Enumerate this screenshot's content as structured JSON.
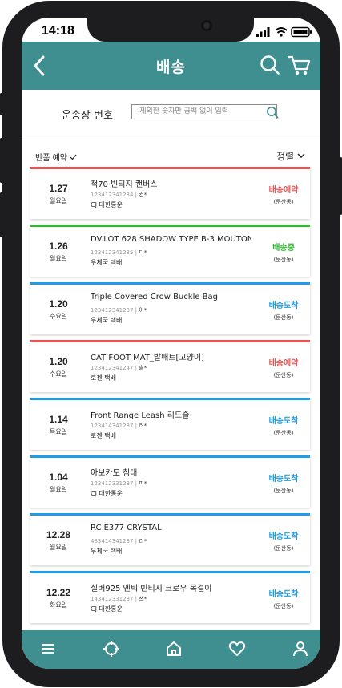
{
  "status_bar": {
    "time": "14:18"
  },
  "header": {
    "title": "배송"
  },
  "search": {
    "label": "운송장 번호",
    "placeholder": "-제외한 숫자만 공백 없이 입력"
  },
  "filter": {
    "returns_label": "반품 예약",
    "sort_label": "정렬"
  },
  "colors": {
    "brand": "#3f8e90",
    "reserved": "#e85555",
    "in_transit": "#2eb82e",
    "delivered": "#1e9be9"
  },
  "shipments": [
    {
      "date": "1.27",
      "day": "월요일",
      "name": "척70 빈티지 캔버스",
      "tracking": "123412341234",
      "recipient": "컨*",
      "carrier": "CJ 대한통운",
      "status": "배송예약",
      "status_type": "reserved",
      "region": "(둔산동)"
    },
    {
      "date": "1.26",
      "day": "월요일",
      "name": "DV.LOT 628 SHADOW TYPE B-3 MOUTON",
      "tracking": "123412341235",
      "recipient": "디*",
      "carrier": "우체국 택배",
      "status": "배송중",
      "status_type": "in_transit",
      "region": "(둔산동)"
    },
    {
      "date": "1.20",
      "day": "수요일",
      "name": "Triple Covered Crow Buckle Bag",
      "tracking": "123412341237",
      "recipient": "이*",
      "carrier": "우체국 택배",
      "status": "배송도착",
      "status_type": "delivered",
      "region": "(둔산동)"
    },
    {
      "date": "1.20",
      "day": "수요일",
      "name": "CAT FOOT MAT_발매트[고양이]",
      "tracking": "123412341247",
      "recipient": "솔*",
      "carrier": "로젠 택배",
      "status": "배송예약",
      "status_type": "reserved",
      "region": "(둔산동)"
    },
    {
      "date": "1.14",
      "day": "목요일",
      "name": "Front Range Leash 리드줄",
      "tracking": "123414341237",
      "recipient": "러*",
      "carrier": "로젠 택배",
      "status": "배송도착",
      "status_type": "delivered",
      "region": "(둔산동)"
    },
    {
      "date": "1.04",
      "day": "월요일",
      "name": "아보카도 침대",
      "tracking": "123412331237",
      "recipient": "피*",
      "carrier": "CJ 대한통운",
      "status": "배송도착",
      "status_type": "delivered",
      "region": "(둔산동)"
    },
    {
      "date": "12.28",
      "day": "월요일",
      "name": "RC E377 CRYSTAL",
      "tracking": "433414341237",
      "recipient": "리*",
      "carrier": "우체국 택배",
      "status": "배송도착",
      "status_type": "delivered",
      "region": "(둔산동)"
    },
    {
      "date": "12.22",
      "day": "화요일",
      "name": "실버925 엔틱 빈티지 크로우 목걸이",
      "tracking": "143412331237",
      "recipient": "쓰*",
      "carrier": "CJ 대한통운",
      "status": "배송도착",
      "status_type": "delivered",
      "region": "(둔산동)"
    }
  ],
  "tabbar": {
    "items": [
      "menu-icon",
      "target-icon",
      "home-icon",
      "heart-icon",
      "user-icon"
    ]
  }
}
